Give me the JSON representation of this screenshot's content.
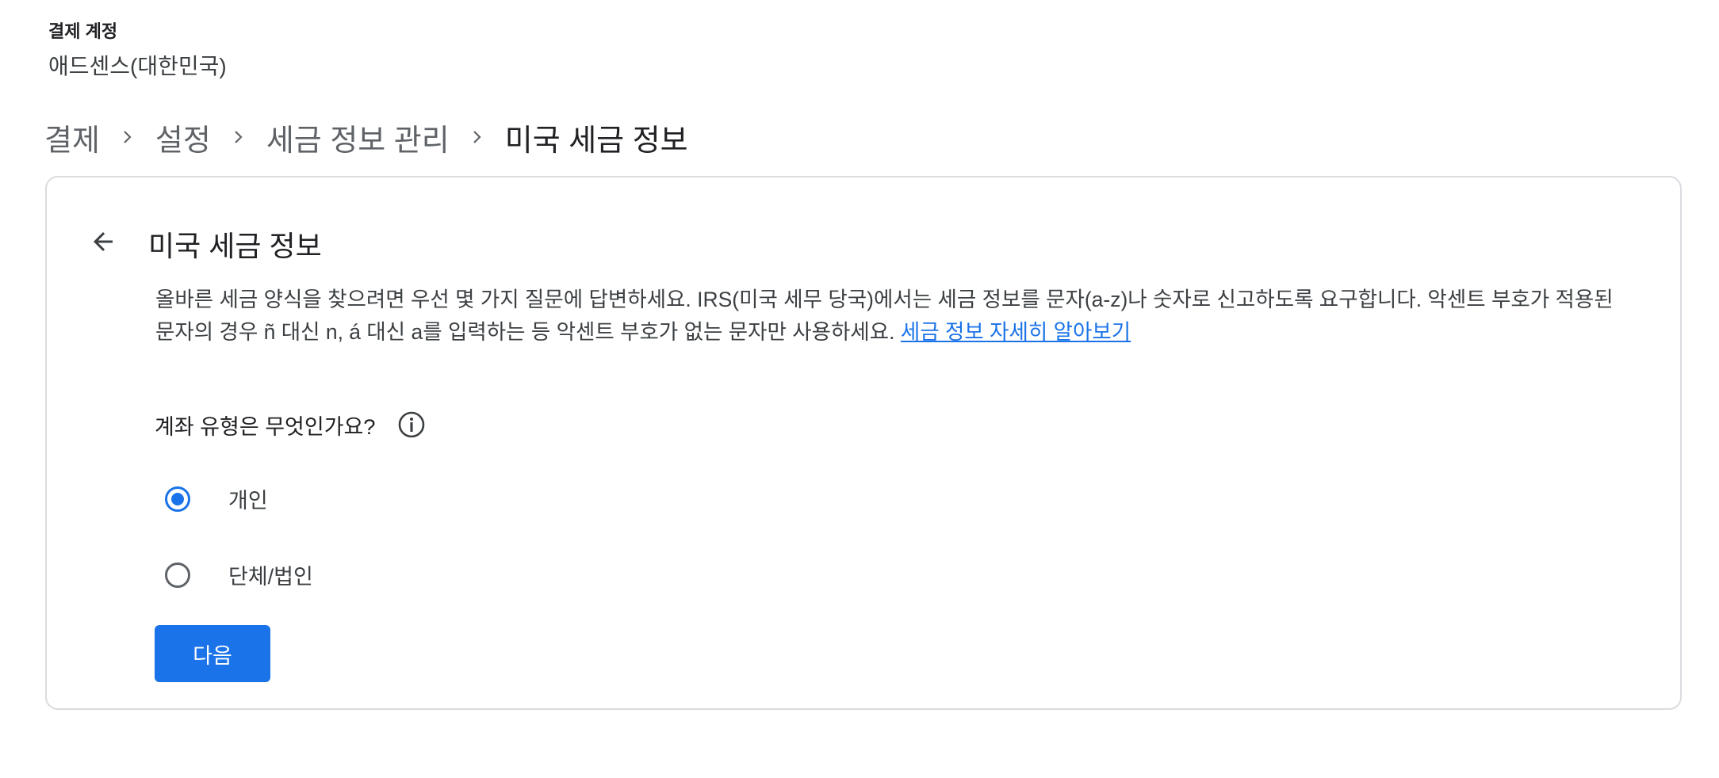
{
  "account": {
    "label": "결제 계정",
    "name": "애드센스(대한민국)"
  },
  "breadcrumb": [
    {
      "label": "결제"
    },
    {
      "label": "설정"
    },
    {
      "label": "세금 정보 관리"
    },
    {
      "label": "미국 세금 정보"
    }
  ],
  "card": {
    "title": "미국 세금 정보",
    "description": "올바른 세금 양식을 찾으려면 우선 몇 가지 질문에 답변하세요. IRS(미국 세무 당국)에서는 세금 정보를 문자(a-z)나 숫자로 신고하도록 요구합니다. 악센트 부호가 적용된 문자의 경우 ñ 대신 n, á 대신 a를 입력하는 등 악센트 부호가 없는 문자만 사용하세요.",
    "learn_more_link": "세금 정보 자세히 알아보기",
    "question": "계좌 유형은 무엇인가요?",
    "options": [
      {
        "label": "개인",
        "selected": true
      },
      {
        "label": "단체/법인",
        "selected": false
      }
    ],
    "next_button": "다음"
  },
  "icons": {
    "back": "arrow-back-icon",
    "info": "info-icon",
    "separator": "chevron-right-icon"
  },
  "colors": {
    "accent": "#1a73e8",
    "text_primary": "#202124",
    "text_secondary": "#5f6368",
    "border": "#dadce0"
  }
}
